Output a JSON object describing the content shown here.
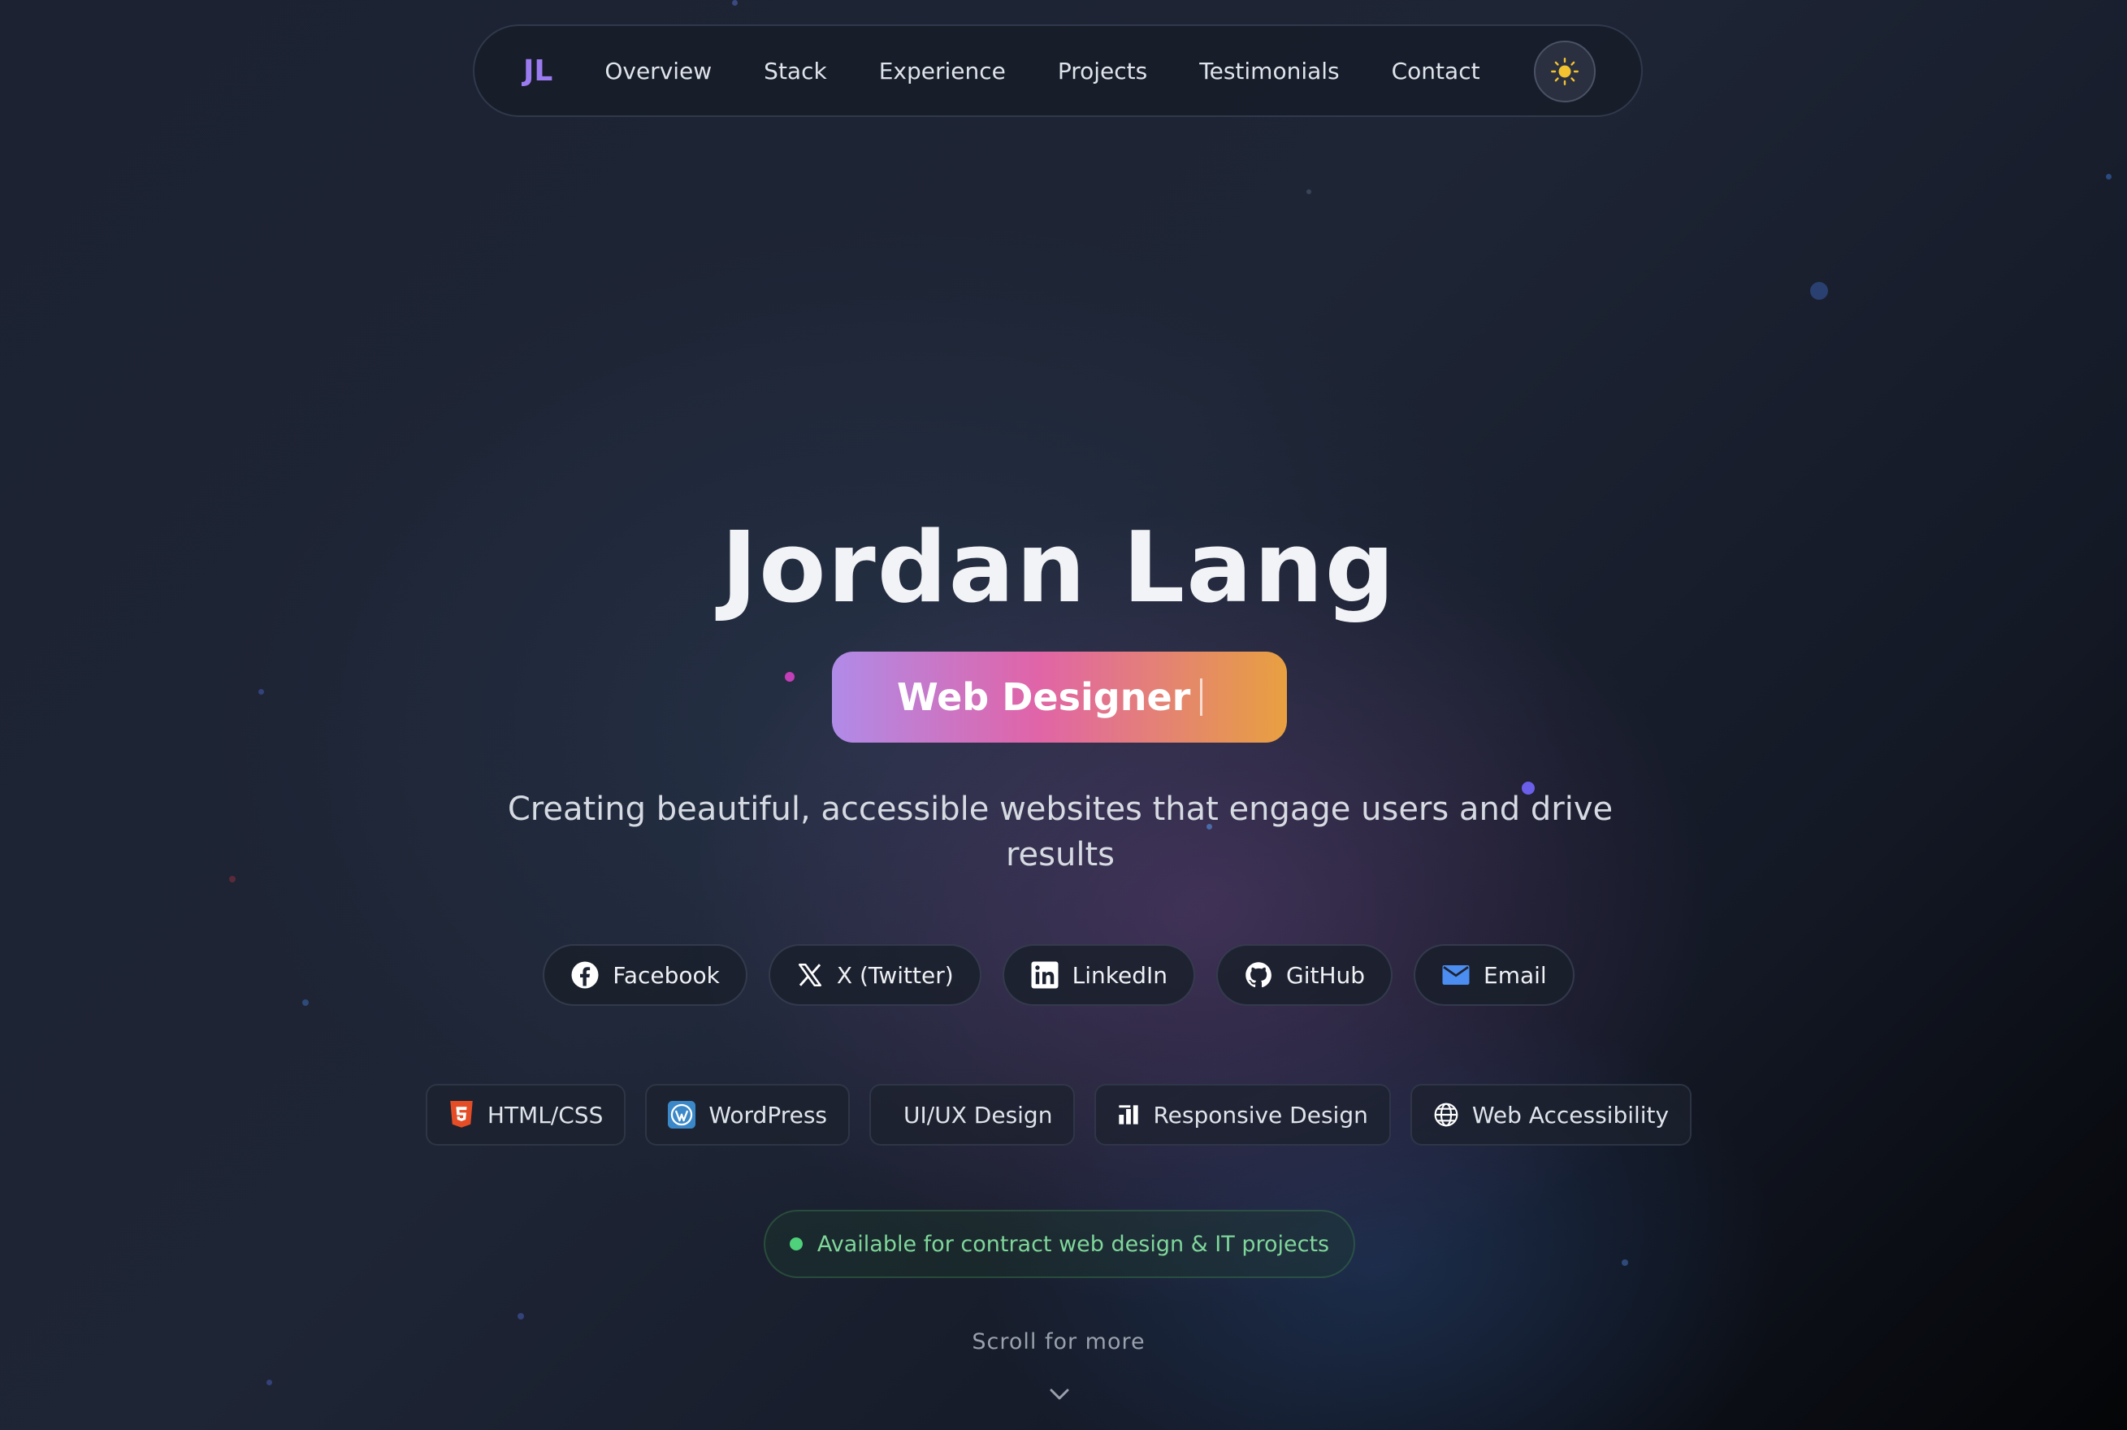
{
  "nav": {
    "logo": "JL",
    "links": [
      "Overview",
      "Stack",
      "Experience",
      "Projects",
      "Testimonials",
      "Contact"
    ],
    "theme_toggle_icon": "sun-icon"
  },
  "hero": {
    "name": "Jordan Lang",
    "role": "Web Designer",
    "tagline": "Creating beautiful, accessible websites that engage users and drive results"
  },
  "socials": [
    {
      "label": "Facebook",
      "icon": "facebook-icon"
    },
    {
      "label": "X (Twitter)",
      "icon": "x-twitter-icon"
    },
    {
      "label": "LinkedIn",
      "icon": "linkedin-icon"
    },
    {
      "label": "GitHub",
      "icon": "github-icon"
    },
    {
      "label": "Email",
      "icon": "email-icon"
    }
  ],
  "skills": [
    {
      "label": "HTML/CSS",
      "icon": "html5-icon"
    },
    {
      "label": "WordPress",
      "icon": "wordpress-icon"
    },
    {
      "label": "UI/UX Design",
      "icon": ""
    },
    {
      "label": "Responsive Design",
      "icon": "bar-chart-icon"
    },
    {
      "label": "Web Accessibility",
      "icon": "globe-icon"
    }
  ],
  "status": "Available for contract web design & IT projects",
  "scroll_hint": "Scroll for more",
  "colors": {
    "accent_purple": "#9b7bf0",
    "gradient_start": "#b08be8",
    "gradient_mid": "#e064a8",
    "gradient_end": "#e8a040",
    "status_green": "#4fd07a",
    "sun_yellow": "#f2c230"
  }
}
